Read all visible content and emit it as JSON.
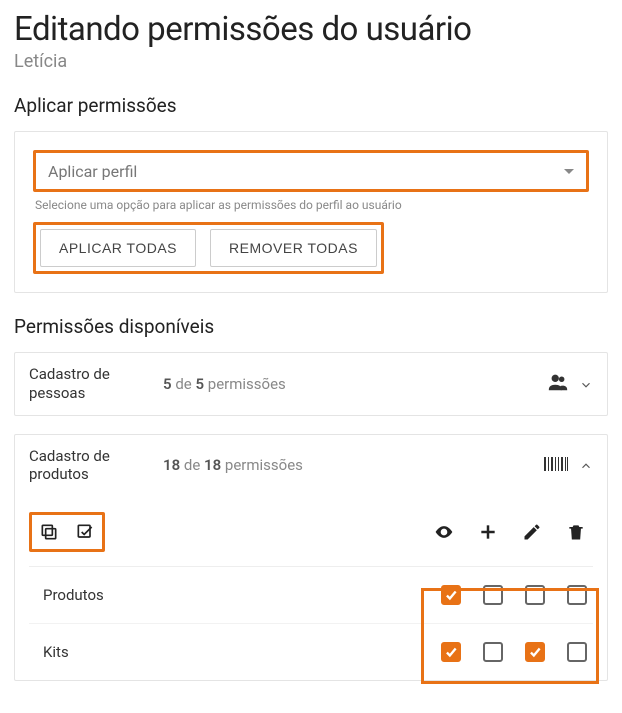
{
  "title": "Editando permissões do usuário",
  "username": "Letícia",
  "apply": {
    "section_label": "Aplicar permissões",
    "select_placeholder": "Aplicar perfil",
    "helper": "Selecione uma opção para aplicar as permissões do perfil ao usuário",
    "apply_all_label": "APLICAR TODAS",
    "remove_all_label": "REMOVER TODAS"
  },
  "available": {
    "section_label": "Permissões disponíveis",
    "of_word": "de",
    "perm_word": "permissões"
  },
  "groups": [
    {
      "name": "Cadastro de pessoas",
      "granted": 5,
      "total": 5,
      "icon": "people",
      "expanded": false
    },
    {
      "name": "Cadastro de produtos",
      "granted": 18,
      "total": 18,
      "icon": "barcode",
      "expanded": true,
      "rows": [
        {
          "label": "Produtos",
          "checks": [
            true,
            false,
            false,
            false
          ]
        },
        {
          "label": "Kits",
          "checks": [
            true,
            false,
            true,
            false
          ]
        }
      ]
    }
  ]
}
